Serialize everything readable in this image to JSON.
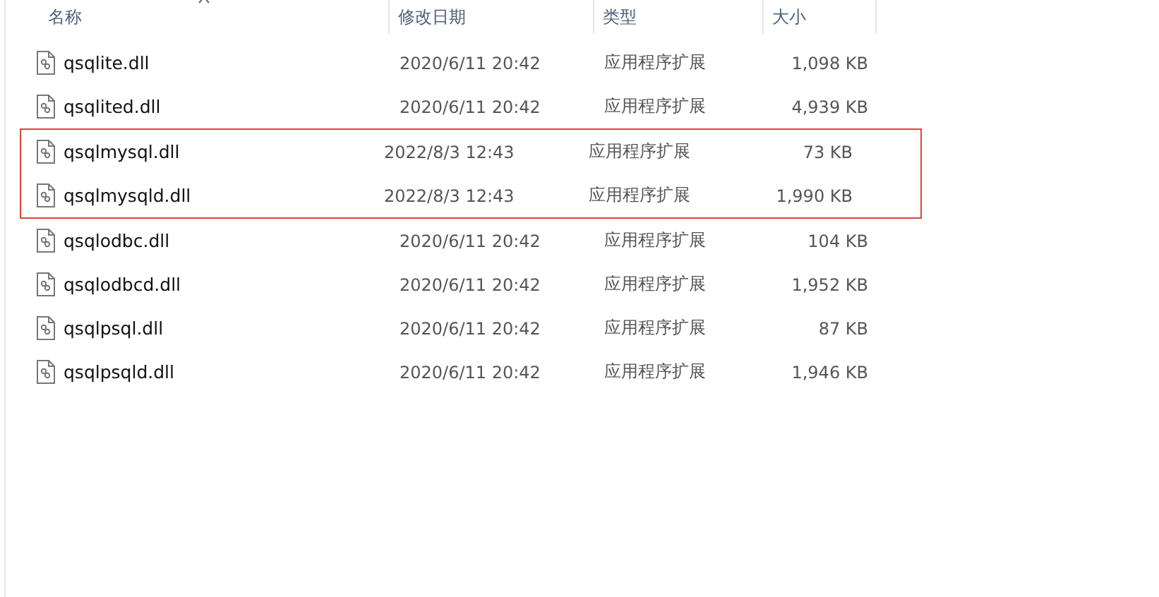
{
  "columns": [
    {
      "label": "名称",
      "sorted": true
    },
    {
      "label": "修改日期",
      "sorted": false
    },
    {
      "label": "类型",
      "sorted": false
    },
    {
      "label": "大小",
      "sorted": false
    }
  ],
  "rows": [
    {
      "name": "qsqlite.dll",
      "date": "2020/6/11 20:42",
      "type": "应用程序扩展",
      "size": "1,098 KB",
      "highlighted": false
    },
    {
      "name": "qsqlited.dll",
      "date": "2020/6/11 20:42",
      "type": "应用程序扩展",
      "size": "4,939 KB",
      "highlighted": false
    },
    {
      "name": "qsqlmysql.dll",
      "date": "2022/8/3 12:43",
      "type": "应用程序扩展",
      "size": "73 KB",
      "highlighted": true
    },
    {
      "name": "qsqlmysqld.dll",
      "date": "2022/8/3 12:43",
      "type": "应用程序扩展",
      "size": "1,990 KB",
      "highlighted": true
    },
    {
      "name": "qsqlodbc.dll",
      "date": "2020/6/11 20:42",
      "type": "应用程序扩展",
      "size": "104 KB",
      "highlighted": false
    },
    {
      "name": "qsqlodbcd.dll",
      "date": "2020/6/11 20:42",
      "type": "应用程序扩展",
      "size": "1,952 KB",
      "highlighted": false
    },
    {
      "name": "qsqlpsql.dll",
      "date": "2020/6/11 20:42",
      "type": "应用程序扩展",
      "size": "87 KB",
      "highlighted": false
    },
    {
      "name": "qsqlpsqld.dll",
      "date": "2020/6/11 20:42",
      "type": "应用程序扩展",
      "size": "1,946 KB",
      "highlighted": false
    }
  ]
}
